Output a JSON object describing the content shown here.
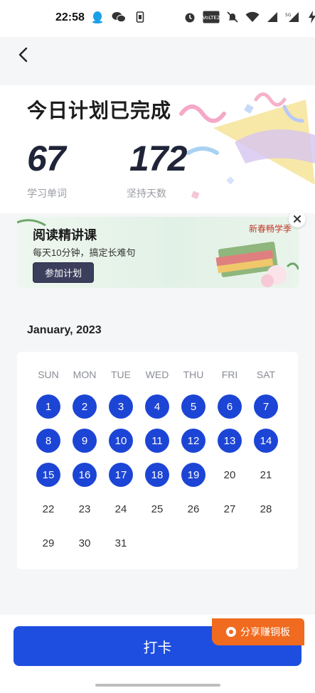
{
  "status_bar": {
    "time": "22:58",
    "left_icons": [
      "qq-icon",
      "wechat-icon",
      "phone-sim-icon"
    ],
    "right_icons": [
      "alarm-icon",
      "volte-icon",
      "mute-icon",
      "wifi-icon",
      "signal-icon",
      "signal-5g-icon",
      "charging-icon"
    ],
    "volte_text": "VoLTE2",
    "fiveg_text": "5G"
  },
  "header": {
    "back_icon": "chevron-left-icon"
  },
  "summary": {
    "title": "今日计划已完成",
    "words_value": "67",
    "words_label": "学习单词",
    "days_value": "172",
    "days_label": "坚持天数"
  },
  "banner": {
    "title": "阅读精讲课",
    "subtitle": "每天10分钟，搞定长难句",
    "button": "参加计划",
    "tag": "新春畅学季",
    "close_icon": "close-icon"
  },
  "calendar": {
    "month_label": "January, 2023",
    "weekdays": [
      "SUN",
      "MON",
      "TUE",
      "WED",
      "THU",
      "FRI",
      "SAT"
    ],
    "start_weekday": 0,
    "days_in_month": 31,
    "checked_days": [
      1,
      2,
      3,
      4,
      5,
      6,
      7,
      8,
      9,
      10,
      11,
      12,
      13,
      14,
      15,
      16,
      17,
      18,
      19
    ],
    "accent_color": "#1c45d6"
  },
  "footer": {
    "checkin_label": "打卡",
    "share_label": "分享赚铜板",
    "button_color": "#1e4ee0",
    "share_color": "#f06a1f"
  }
}
